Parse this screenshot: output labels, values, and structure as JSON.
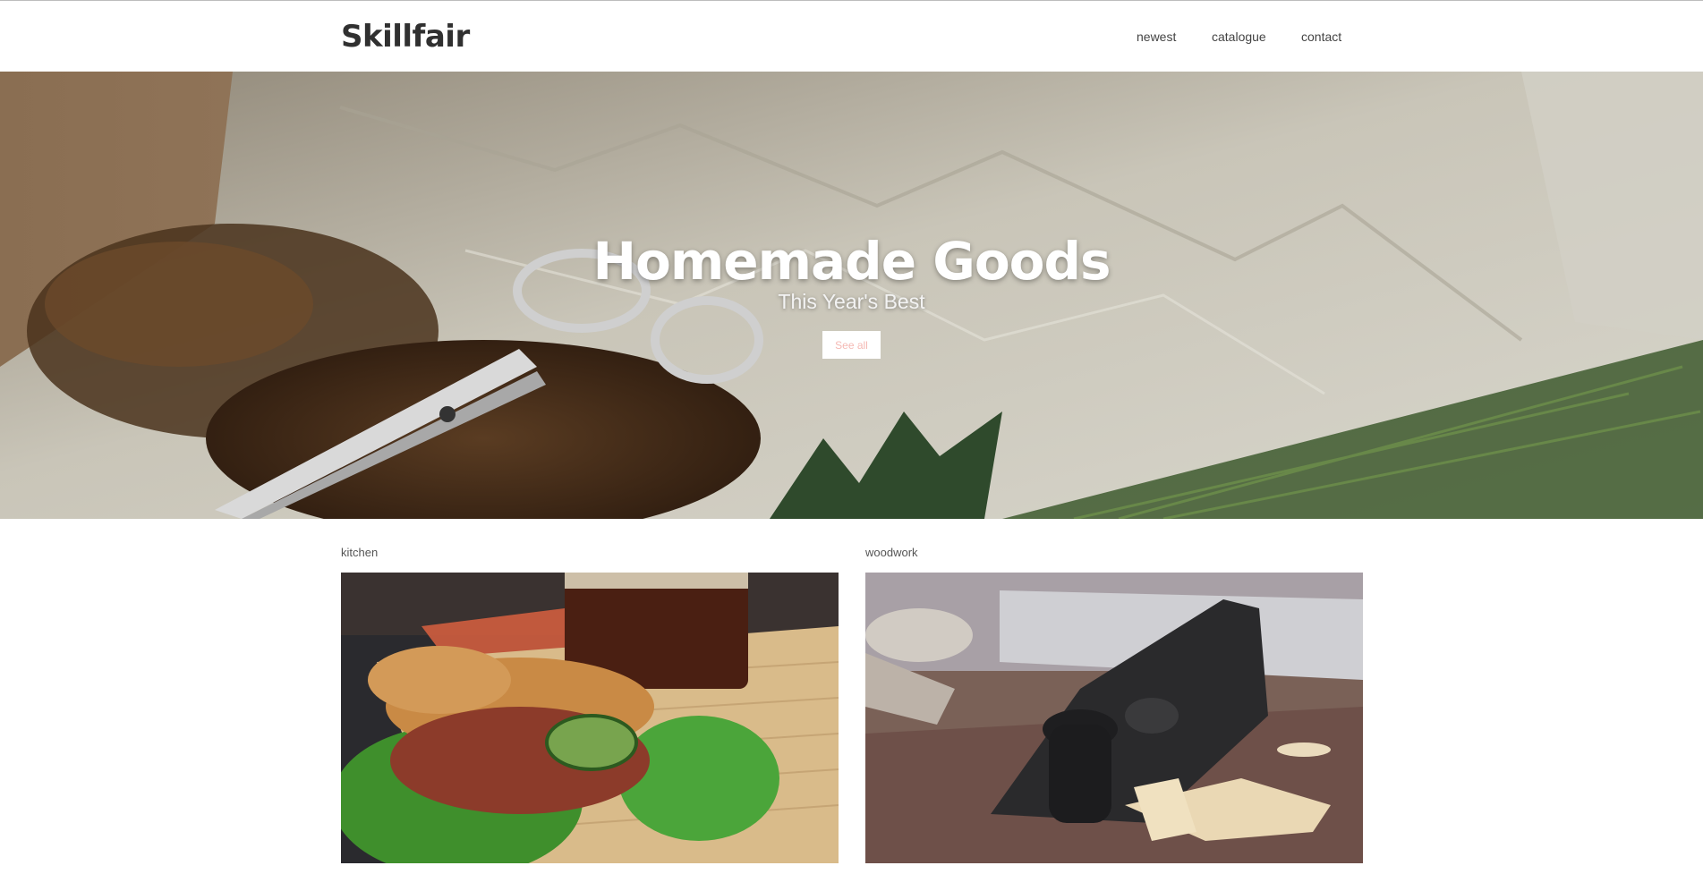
{
  "header": {
    "logo": "Skillfair",
    "nav": [
      {
        "label": "newest"
      },
      {
        "label": "catalogue"
      },
      {
        "label": "contact"
      }
    ]
  },
  "hero": {
    "title": "Homemade Goods",
    "subtitle": "This Year's Best",
    "button_label": "See all"
  },
  "categories": [
    {
      "label": "kitchen"
    },
    {
      "label": "woodwork"
    }
  ],
  "colors": {
    "text": "#333333",
    "button_text": "#f5b9b4",
    "background": "#ffffff"
  }
}
